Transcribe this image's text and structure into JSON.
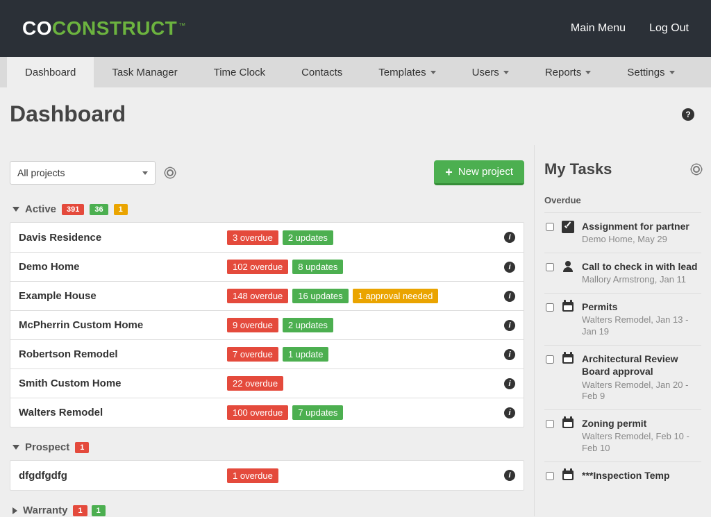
{
  "logo": {
    "co": "CO",
    "construct": "CONSTRUCT",
    "tm": "™"
  },
  "topLinks": {
    "mainMenu": "Main Menu",
    "logout": "Log Out"
  },
  "tabs": [
    {
      "label": "Dashboard",
      "dropdown": false,
      "active": true
    },
    {
      "label": "Task Manager",
      "dropdown": false,
      "active": false
    },
    {
      "label": "Time Clock",
      "dropdown": false,
      "active": false
    },
    {
      "label": "Contacts",
      "dropdown": false,
      "active": false
    },
    {
      "label": "Templates",
      "dropdown": true,
      "active": false
    },
    {
      "label": "Users",
      "dropdown": true,
      "active": false
    },
    {
      "label": "Reports",
      "dropdown": true,
      "active": false
    },
    {
      "label": "Settings",
      "dropdown": true,
      "active": false
    }
  ],
  "pageTitle": "Dashboard",
  "filterSelected": "All projects",
  "newProjectLabel": "New project",
  "sections": [
    {
      "title": "Active",
      "collapsed": false,
      "counts": [
        {
          "n": "391",
          "t": "red"
        },
        {
          "n": "36",
          "t": "green"
        },
        {
          "n": "1",
          "t": "orange"
        }
      ],
      "rows": [
        {
          "name": "Davis Residence",
          "badges": [
            {
              "text": "3 overdue",
              "t": "red"
            },
            {
              "text": "2 updates",
              "t": "green"
            }
          ]
        },
        {
          "name": "Demo Home",
          "badges": [
            {
              "text": "102 overdue",
              "t": "red"
            },
            {
              "text": "8 updates",
              "t": "green"
            }
          ]
        },
        {
          "name": "Example House",
          "badges": [
            {
              "text": "148 overdue",
              "t": "red"
            },
            {
              "text": "16 updates",
              "t": "green"
            },
            {
              "text": "1 approval needed",
              "t": "orange"
            }
          ]
        },
        {
          "name": "McPherrin Custom Home",
          "badges": [
            {
              "text": "9 overdue",
              "t": "red"
            },
            {
              "text": "2 updates",
              "t": "green"
            }
          ]
        },
        {
          "name": "Robertson Remodel",
          "badges": [
            {
              "text": "7 overdue",
              "t": "red"
            },
            {
              "text": "1 update",
              "t": "green"
            }
          ]
        },
        {
          "name": "Smith Custom Home",
          "badges": [
            {
              "text": "22 overdue",
              "t": "red"
            }
          ]
        },
        {
          "name": "Walters Remodel",
          "badges": [
            {
              "text": "100 overdue",
              "t": "red"
            },
            {
              "text": "7 updates",
              "t": "green"
            }
          ]
        }
      ]
    },
    {
      "title": "Prospect",
      "collapsed": false,
      "counts": [
        {
          "n": "1",
          "t": "red"
        }
      ],
      "rows": [
        {
          "name": "dfgdfgdfg",
          "badges": [
            {
              "text": "1 overdue",
              "t": "red"
            }
          ]
        }
      ]
    }
  ],
  "warranty": {
    "title": "Warranty",
    "counts": [
      {
        "n": "1",
        "t": "red"
      },
      {
        "n": "1",
        "t": "green"
      }
    ],
    "collapsed": true
  },
  "sidebar": {
    "title": "My Tasks",
    "overdueLabel": "Overdue",
    "tasks": [
      {
        "icon": "check",
        "title": "Assignment for partner",
        "sub": "Demo Home, May 29"
      },
      {
        "icon": "person",
        "title": "Call to check in with lead",
        "sub": "Mallory Armstrong, Jan 11"
      },
      {
        "icon": "cal",
        "title": "Permits",
        "sub": "Walters Remodel, Jan 13 - Jan 19"
      },
      {
        "icon": "cal",
        "title": "Architectural Review Board approval",
        "sub": "Walters Remodel, Jan 20 - Feb 9"
      },
      {
        "icon": "cal",
        "title": "Zoning permit",
        "sub": "Walters Remodel, Feb 10 - Feb 10"
      },
      {
        "icon": "cal",
        "title": "***Inspection Temp",
        "sub": ""
      }
    ]
  }
}
